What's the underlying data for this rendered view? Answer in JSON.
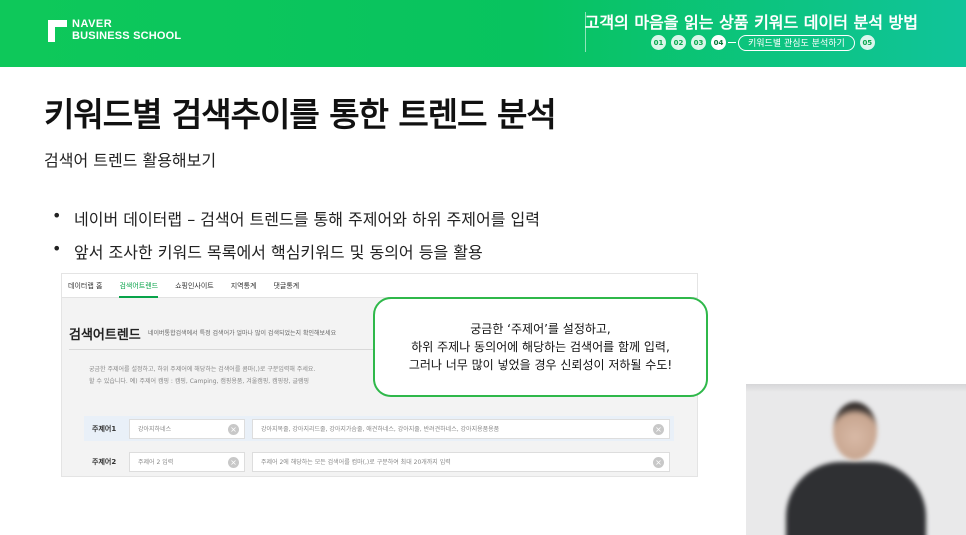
{
  "header": {
    "brand_line1": "NAVER",
    "brand_line2": "BUSINESS SCHOOL",
    "course_title": "고객의 마음을 읽는 상품 키워드 데이터 분석 방법",
    "steps": [
      "01",
      "02",
      "03",
      "04",
      "05"
    ],
    "active_step": "04",
    "active_step_label": "키워드별 관심도 분석하기",
    "colors": {
      "banner": "#0ec85a",
      "accent": "#08a34a"
    }
  },
  "slide": {
    "title": "키워드별 검색추이를 통한 트렌드 분석",
    "subtitle": "검색어 트렌드 활용해보기",
    "bullet_glyph": "•",
    "bullets": [
      "네이버 데이터랩 – 검색어 트렌드를 통해 주제어와 하위 주제어를 입력",
      "앞서 조사한 키워드 목록에서 핵심키워드 및 동의어 등을 활용"
    ]
  },
  "datalab": {
    "nav": [
      "데이터랩 홈",
      "검색어트렌드",
      "쇼핑인사이트",
      "지역통계",
      "댓글통계"
    ],
    "active_nav": "검색어트렌드",
    "title": "검색어트렌드",
    "description": "네이버통합검색에서 특정 검색어가 얼마나 많이 검색되었는지 확인해보세요",
    "help_line1": "궁금한 주제어를 설정하고, 하위 주제어에 해당하는 검색어를 콤마(,)로 구분입력해 주세요.",
    "help_line2": "할 수 있습니다. 예) 주제어 캠핑 : 캠핑, Camping, 캠핑용품, 겨울캠핑, 캠핑장, 글램핑",
    "rows": [
      {
        "label": "주제어1",
        "topic_value": "강아지하네스",
        "keywords_value": "강아지목줄, 강아지리드줄, 강아지가슴줄, 애견하네스, 강아지줄, 반려견하네스, 강아지용품용품"
      },
      {
        "label": "주제어2",
        "topic_placeholder": "주제어 2 입력",
        "keywords_placeholder": "주제어 2에 해당하는 모든 검색어를 컴마(,)로 구분하여 최대 20개까지 입력"
      }
    ],
    "clear_glyph": "×"
  },
  "callout": {
    "lines": [
      "궁금한 ‘주제어’를 설정하고,",
      "하위 주제나 동의어에 해당하는 검색어를 함께 입력,",
      "그러나 너무 많이 넣었을 경우 신뢰성이 저하될 수도!"
    ],
    "border_color": "#2fb84a"
  }
}
